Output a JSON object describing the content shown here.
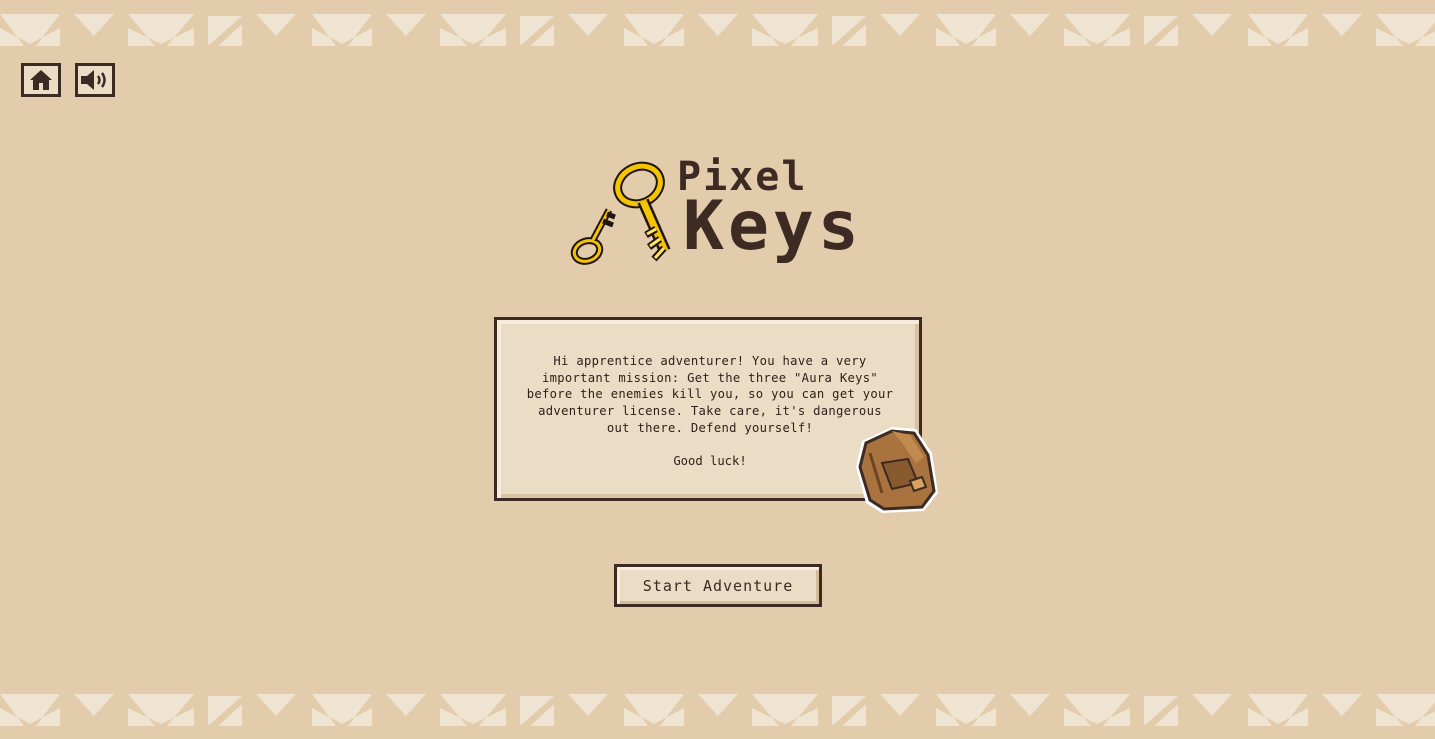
{
  "game": {
    "title_line1": "Pixel",
    "title_line2": "Keys"
  },
  "toolbar": {
    "home_icon": "home-icon",
    "sound_icon": "speaker-icon"
  },
  "intro": {
    "message": "Hi apprentice adventurer! You have a very important mission: Get the three \"Aura Keys\" before the enemies kill you, so you can get your adventurer license. Take care, it's dangerous out there. Defend yourself!",
    "closing": "Good luck!"
  },
  "actions": {
    "start_label": "Start Adventure"
  },
  "colors": {
    "background": "#e2ccab",
    "panel": "#ebdcc5",
    "ink": "#3d2a22",
    "pattern": "#efe3d1",
    "key_gold": "#f5c400",
    "backpack": "#a8733f"
  }
}
